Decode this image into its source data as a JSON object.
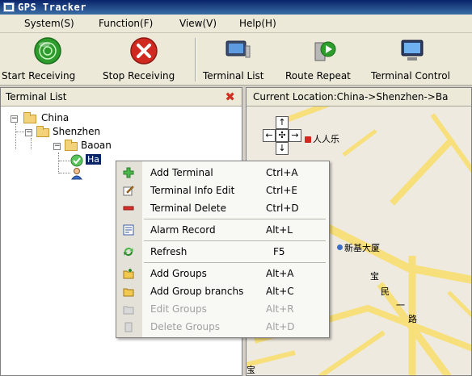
{
  "window": {
    "title": "GPS Tracker"
  },
  "menubar": {
    "items": [
      "System(S)",
      "Function(F)",
      "View(V)",
      "Help(H)"
    ]
  },
  "toolbar": {
    "start_receiving": "Start Receiving",
    "stop_receiving": "Stop Receiving",
    "terminal_list": "Terminal List",
    "route_repeat": "Route Repeat",
    "terminal_control": "Terminal Control"
  },
  "left_panel": {
    "title": "Terminal List",
    "close": "✖"
  },
  "tree": {
    "china": "China",
    "shenzhen": "Shenzhen",
    "baoan": "Baoan",
    "terminal": "Ha"
  },
  "right_panel": {
    "location": "Current Location:China->Shenzhen->Ba"
  },
  "map": {
    "labels": {
      "poi_1": "人人乐",
      "poi_2": "新基大厦",
      "road_1": "宝",
      "road_2": "民",
      "road_3": "一",
      "road_4": "路",
      "road_5": "宝"
    },
    "nav": {
      "up": "↑",
      "down": "↓",
      "left": "←",
      "right": "→",
      "center": "✣"
    }
  },
  "context_menu": {
    "items": [
      {
        "label": "Add Terminal",
        "shortcut": "Ctrl+A",
        "icon": "add-terminal-icon",
        "enabled": true
      },
      {
        "label": "Terminal Info Edit",
        "shortcut": "Ctrl+E",
        "icon": "edit-icon",
        "enabled": true
      },
      {
        "label": "Terminal Delete",
        "shortcut": "Ctrl+D",
        "icon": "delete-icon",
        "enabled": true
      },
      {
        "label": "Alarm Record",
        "shortcut": "Alt+L",
        "icon": "alarm-record-icon",
        "enabled": true
      },
      {
        "label": "Refresh",
        "shortcut": "F5",
        "icon": "refresh-icon",
        "enabled": true
      },
      {
        "label": "Add Groups",
        "shortcut": "Alt+A",
        "icon": "add-group-icon",
        "enabled": true
      },
      {
        "label": "Add Group branchs",
        "shortcut": "Alt+C",
        "icon": "add-group-branch-icon",
        "enabled": true
      },
      {
        "label": "Edit Groups",
        "shortcut": "Alt+R",
        "icon": "edit-group-icon",
        "enabled": false
      },
      {
        "label": "Delete Groups",
        "shortcut": "Alt+D",
        "icon": "delete-group-icon",
        "enabled": false
      }
    ]
  },
  "colors": {
    "titlebar": "#0a246a",
    "map_road": "#f7e07c",
    "map_bg": "#eeeae0",
    "stop_red": "#d02a20",
    "start_green": "#2d9c2d"
  }
}
